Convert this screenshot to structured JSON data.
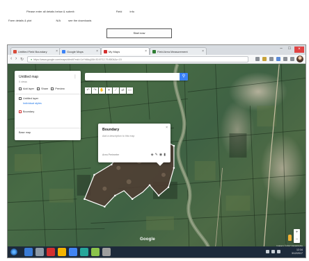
{
  "form": {
    "line1_label": "Please enter all details below & submit:",
    "line1_value": "Field",
    "line1_suffix": "info",
    "line2_label": "Farm details & plot",
    "line2_value": "N/A",
    "line2_suffix": "see the downloads",
    "submit_label": "Start now"
  },
  "browser": {
    "tabs": [
      {
        "label": "Untitled Field Boundary",
        "favicon_color": "#d84b3a"
      },
      {
        "label": "Google Maps",
        "favicon_color": "#3b82f6"
      },
      {
        "label": "My Maps",
        "favicon_color": "#d32f2f"
      },
      {
        "label": "Field Area Measurement",
        "favicon_color": "#2e7d32"
      }
    ],
    "active_tab_index": 2,
    "url": "https://www.google.com/maps/d/edit?mid=1zYh6kqJ&ll=30.8712,75.8504&z=15",
    "window_controls": [
      "–",
      "□",
      "×"
    ]
  },
  "panel": {
    "title": "Untitled map",
    "subtitle": "0 views",
    "options": [
      "Add layer",
      "Share",
      "Preview"
    ],
    "layer_name": "Untitled layer",
    "layer_style": "Individual styles",
    "basemap": "Base map",
    "footer_link": "Base map"
  },
  "search": {
    "placeholder": ""
  },
  "popup": {
    "title": "Boundary",
    "description": "Add a description to this map",
    "footer": "Area  Perimeter",
    "icons": [
      "paint-icon",
      "edit-icon",
      "camera-icon",
      "delete-icon"
    ]
  },
  "map": {
    "logo": "Google",
    "attribution": "Imagery ©2017 DigitalGlobe",
    "plot_color": "#ffffff"
  },
  "taskbar": {
    "time": "12:34",
    "date": "3/12/2017",
    "apps": [
      "#3a7bd5",
      "#8e9aa6",
      "#d32f2f",
      "#f4b400",
      "#4285f4",
      "#26a69a",
      "#8bc34a",
      "#9e9e9e"
    ]
  }
}
